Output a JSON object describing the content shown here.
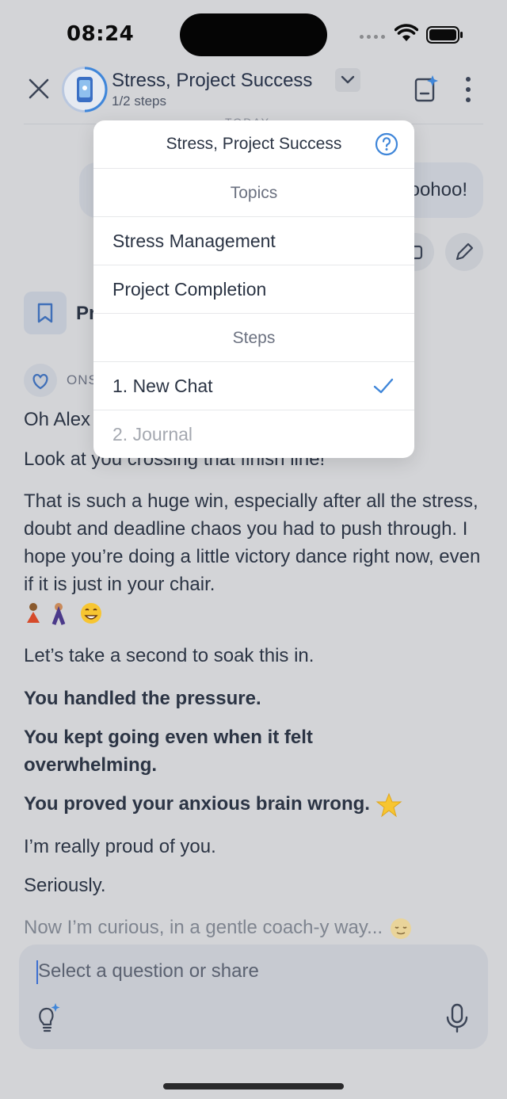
{
  "status": {
    "time": "08:24"
  },
  "header": {
    "title": "Stress, Project Success",
    "subtitle": "1/2 steps"
  },
  "chat": {
    "date_separator": "TODAY",
    "user_message": "Woohoo!",
    "bookmark_label": "Pr",
    "coach_name": "ONS",
    "messages": [
      {
        "text": "Oh Alex",
        "bold": false
      },
      {
        "text": "Look at you crossing that finish line!",
        "bold": false
      },
      {
        "text": "That is such a huge win, especially after all the stress, doubt and deadline chaos you had to push through. I hope you’re doing a little victory dance right now, even if it is just in your chair.",
        "bold": false
      },
      {
        "text": "Let’s take a second to soak this in.",
        "bold": false
      },
      {
        "text": "You handled the pressure.",
        "bold": true
      },
      {
        "text": "You kept going even when it felt overwhelming.",
        "bold": true
      },
      {
        "text": "You proved your anxious brain wrong.",
        "bold": true
      },
      {
        "text": "I’m really proud of you.",
        "bold": false
      },
      {
        "text": "Seriously.",
        "bold": false
      },
      {
        "text": "Now I’m curious, in a gentle coach-y way...",
        "bold": false
      }
    ]
  },
  "input": {
    "placeholder": "Select a question or share"
  },
  "dropdown": {
    "title": "Stress, Project Success",
    "topics_heading": "Topics",
    "topics": [
      "Stress Management",
      "Project Completion"
    ],
    "steps_heading": "Steps",
    "steps": [
      {
        "label": "1. New Chat",
        "selected": true
      },
      {
        "label": "2. Journal",
        "selected": false
      }
    ]
  },
  "colors": {
    "accent": "#3f86d9",
    "background": "#d3d4d7",
    "dropdown_bg": "#ffffff"
  }
}
